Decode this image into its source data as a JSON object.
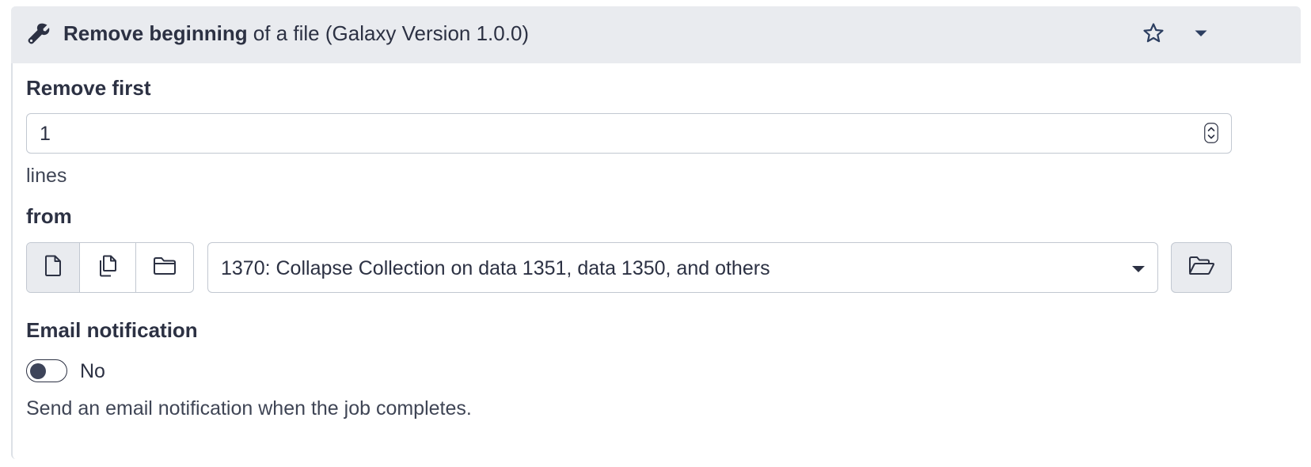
{
  "header": {
    "title_bold": "Remove beginning",
    "title_rest": " of a file (Galaxy Version 1.0.0)",
    "icon": "wrench-icon",
    "favorite_icon": "star-icon",
    "options_icon": "caret-down-icon"
  },
  "remove_first": {
    "label": "Remove first",
    "value": "1",
    "help": "lines"
  },
  "from": {
    "label": "from",
    "source_buttons": [
      "single-dataset-icon",
      "multiple-datasets-icon",
      "collection-folder-icon"
    ],
    "selected": "1370: Collapse Collection on data 1351, data 1350, and others",
    "browse_icon": "folder-open-icon"
  },
  "email": {
    "label": "Email notification",
    "toggle_state": "No",
    "help": "Send an email notification when the job completes."
  },
  "colors": {
    "header_bg": "#e9ebef",
    "text": "#2c3143",
    "border": "#c2c8d1",
    "icon_blue": "#2c3e60"
  }
}
